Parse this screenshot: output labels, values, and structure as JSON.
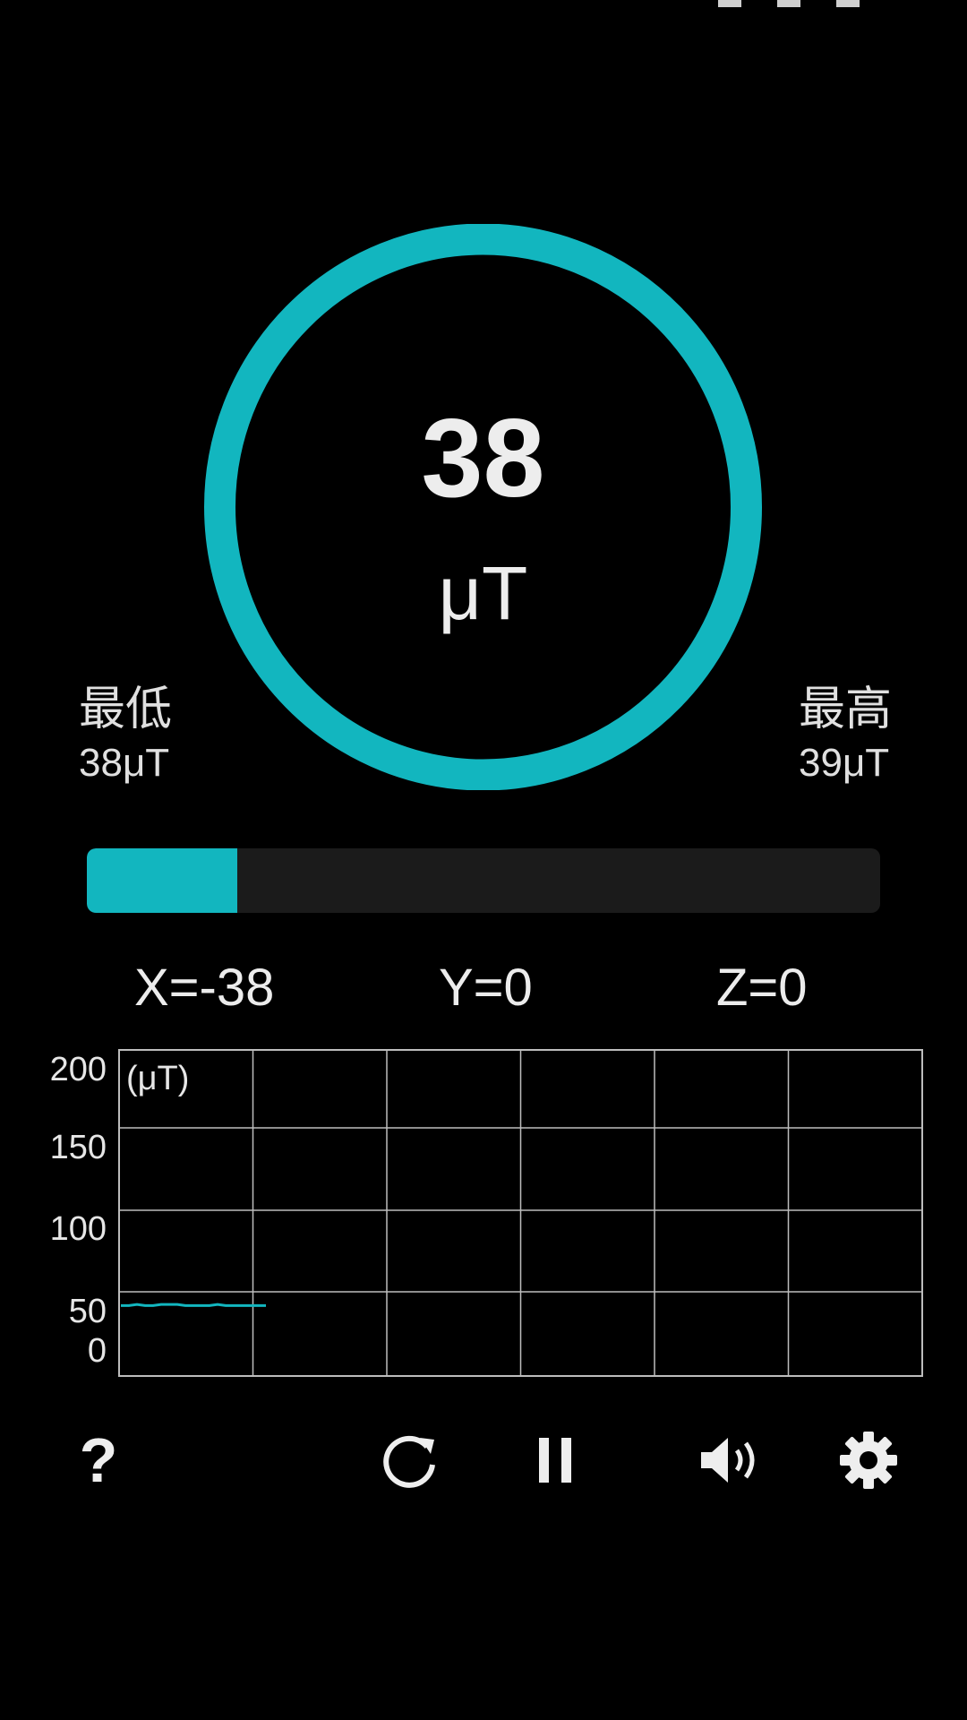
{
  "colors": {
    "accent": "#12b6bf",
    "background": "#000000",
    "track": "#1b1b1b",
    "text": "#ececec",
    "grid": "#bdbdbd"
  },
  "reading": {
    "value": "38",
    "unit": "μT"
  },
  "min": {
    "label": "最低",
    "value": "38μT"
  },
  "max": {
    "label": "最高",
    "value": "39μT"
  },
  "progress": {
    "fraction": 0.19
  },
  "axes": {
    "x": "X=-38",
    "y": "Y=0",
    "z": "Z=0"
  },
  "chart_data": {
    "type": "line",
    "ylabel": "(μT)",
    "yticks": [
      "0",
      "50",
      "100",
      "150",
      "200"
    ],
    "ylim": [
      0,
      200
    ],
    "grid": true,
    "series": [
      {
        "values": [
          38,
          38,
          39,
          38,
          38,
          39,
          39,
          39,
          38,
          38,
          38,
          38,
          39,
          38,
          38,
          38,
          38,
          38,
          38
        ]
      }
    ]
  },
  "toolbar": {
    "help_label": "?",
    "icons": [
      "help-icon",
      "reset-icon",
      "pause-icon",
      "sound-icon",
      "settings-icon"
    ]
  }
}
